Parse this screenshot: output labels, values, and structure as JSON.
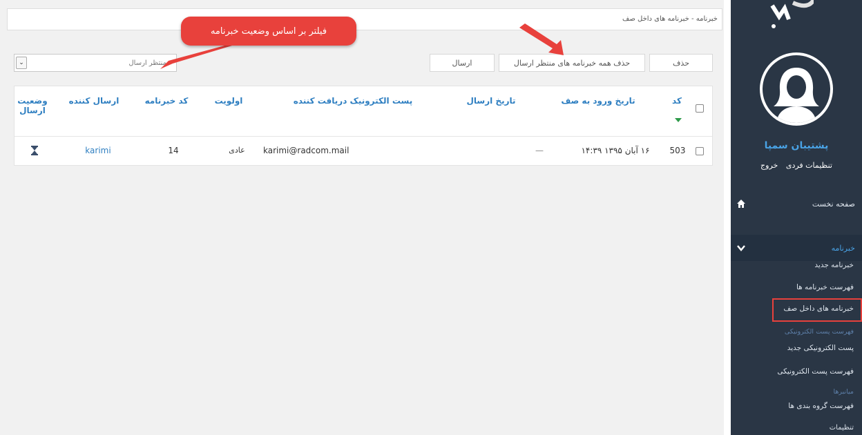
{
  "breadcrumb": "خبرنامه - خبرنامه های داخل صف",
  "toolbar": {
    "delete_label": "حذف",
    "delete_all_pending_label": "حذف همه خبرنامه های منتظر ارسال",
    "send_label": "ارسال"
  },
  "filter": {
    "selected": "منتظر ارسال"
  },
  "callout_text": "فیلتر بر اساس وضعیت خبرنامه",
  "table": {
    "headers": {
      "code": "کد",
      "queue_date": "تاریخ ورود به صف",
      "send_date": "تاریخ ارسال",
      "recipient_email": "پست الکترونیک دریافت کننده",
      "priority": "اولویت",
      "newsletter_code": "کد خبرنامه",
      "sender": "ارسال کننده",
      "send_status": "وضعیت ارسال"
    },
    "rows": [
      {
        "code": "503",
        "queue_date": "۱۶ آبان ۱۳۹۵ ۱۴:۳۹",
        "send_date": "—",
        "recipient_email": "karimi@radcom.mail",
        "priority": "عادی",
        "newsletter_code": "14",
        "sender": "karimi",
        "send_status_icon": "hourglass-icon"
      }
    ]
  },
  "sidebar": {
    "user_name": "پشتیبان سمپا",
    "settings_link": "تنظیمات فردی",
    "logout_link": "خروج",
    "home": "صفحه نخست",
    "newsletter_section": "خبرنامه",
    "items": {
      "new_newsletter": "خبرنامه جدید",
      "newsletter_list": "فهرست خبرنامه ها",
      "queued_newsletters": "خبرنامه های داخل صف",
      "email_list_category": "فهرست پست الکترونیکی",
      "new_email": "پست الکترونیکی جدید",
      "email_list": "فهرست پست الکترونیکی",
      "shortcuts_category": "میانبرها",
      "group_list": "فهرست گروه بندی ها",
      "settings_category": "تنظیمات"
    }
  },
  "colors": {
    "accent": "#2f7fc1",
    "callout": "#e8413c",
    "sidebar_bg": "#2a3645",
    "user_name": "#49a3e6"
  }
}
